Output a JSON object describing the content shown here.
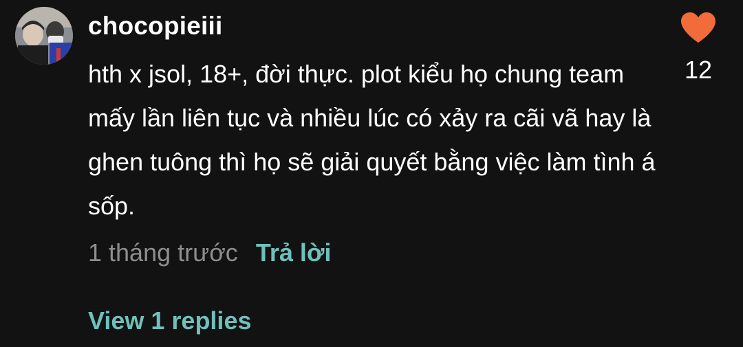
{
  "comment": {
    "username": "chocopieiii",
    "text": "hth x jsol, 18+, đời thực. plot kiểu họ chung team mấy lần liên tục và nhiều lúc có xảy ra cãi vã hay là ghen tuông thì họ sẽ giải quyết bằng việc làm tình á sốp.",
    "timestamp": "1 tháng trước",
    "reply_label": "Trả lời",
    "view_replies_label": "View 1 replies",
    "like_count": "12",
    "liked": true
  },
  "icons": {
    "like": "heart-icon",
    "avatar": "avatar"
  },
  "colors": {
    "background": "#121212",
    "heart": "#f26b3a",
    "accent": "#6fc0bb",
    "muted": "#8e8e8e"
  }
}
